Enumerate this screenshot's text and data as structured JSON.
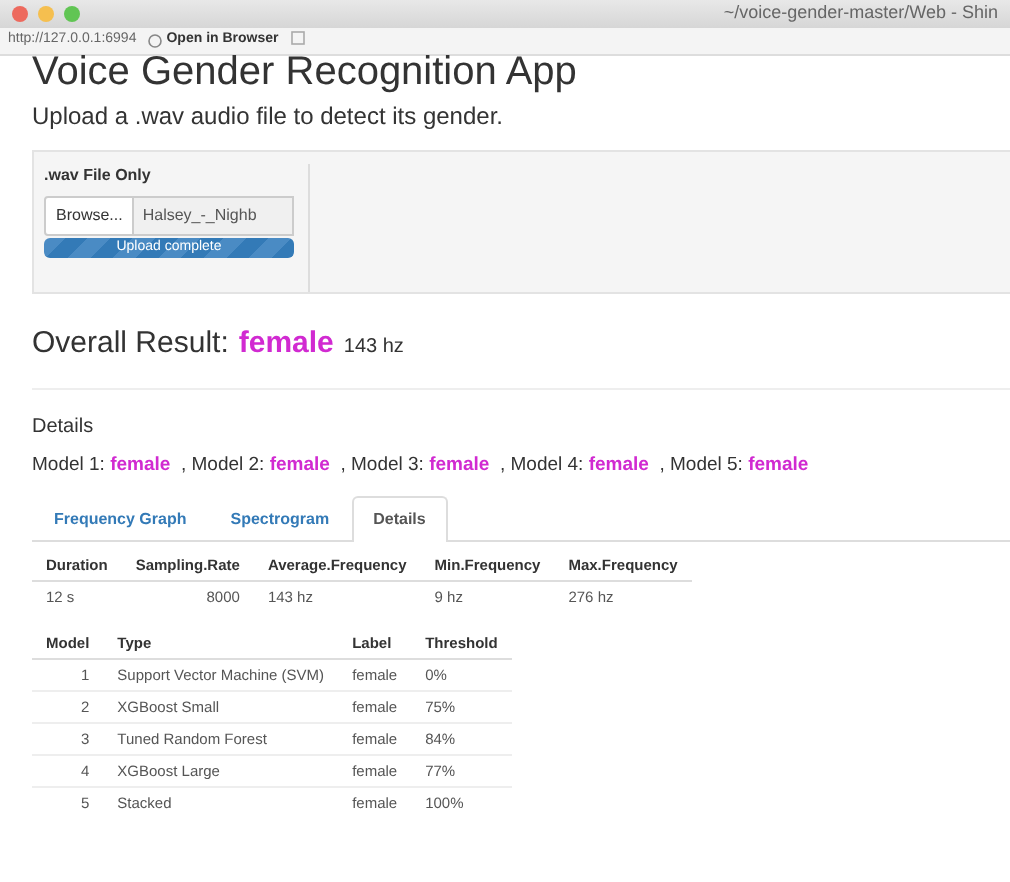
{
  "window": {
    "title": "~/voice-gender-master/Web - Shin"
  },
  "toolbar": {
    "url": "http://127.0.0.1:6994",
    "open_button": "Open in Browser"
  },
  "heading": "Voice Gender Recognition App",
  "subtitle": "Upload a .wav audio file to detect its gender.",
  "upload": {
    "label": ".wav File Only",
    "browse_button": "Browse...",
    "file_name": "Halsey_-_Nighb",
    "progress": {
      "level": 1,
      "text": "Upload complete"
    }
  },
  "overall": {
    "label": "Overall Result:",
    "result": "female",
    "frequency": "143 hz"
  },
  "details": {
    "title": "Details",
    "models": [
      {
        "label": "Model 1:",
        "result": "female",
        "separator": ","
      },
      {
        "label": "Model 2:",
        "result": "female",
        "separator": ","
      },
      {
        "label": "Model 3:",
        "result": "female",
        "separator": ","
      },
      {
        "label": "Model 4:",
        "result": "female",
        "separator": ","
      },
      {
        "label": "Model 5:",
        "result": "female"
      }
    ]
  },
  "tabs": [
    {
      "label": "Frequency Graph",
      "selected": false
    },
    {
      "label": "Spectrogram",
      "selected": false
    },
    {
      "label": "Details",
      "selected": true
    }
  ],
  "summary_table": {
    "columns": [
      "Duration",
      "Sampling.Rate",
      "Average.Frequency",
      "Min.Frequency",
      "Max.Frequency"
    ],
    "rows": [
      [
        "12 s",
        "8000",
        "143 hz",
        "9 hz",
        "276 hz"
      ]
    ]
  },
  "models_table": {
    "columns": [
      "Model",
      "Type",
      "Label",
      "Threshold"
    ],
    "rows": [
      [
        "1",
        "Support Vector Machine (SVM)",
        "female",
        "0%"
      ],
      [
        "2",
        "XGBoost Small",
        "female",
        "75%"
      ],
      [
        "3",
        "Tuned Random Forest",
        "female",
        "84%"
      ],
      [
        "4",
        "XGBoost Large",
        "female",
        "77%"
      ],
      [
        "5",
        "Stacked",
        "female",
        "100%"
      ]
    ]
  }
}
